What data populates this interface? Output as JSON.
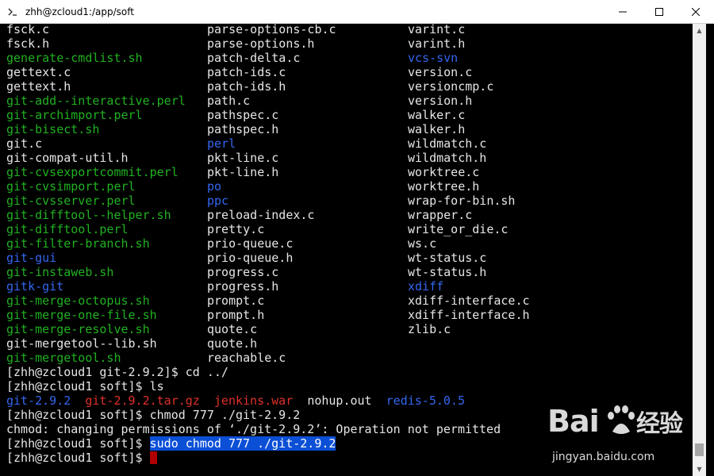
{
  "window": {
    "title": "zhh@zcloud1:/app/soft"
  },
  "colors": {
    "green": "#21b121",
    "blue": "#3467f0",
    "red": "#e0302a",
    "white": "#e6e6e6",
    "selection": "#0b4fd6",
    "cursor": "#b00000"
  },
  "listing": [
    [
      {
        "t": "fsck.c",
        "c": "w"
      },
      {
        "t": "parse-options-cb.c",
        "c": "w"
      },
      {
        "t": "varint.c",
        "c": "w"
      }
    ],
    [
      {
        "t": "fsck.h",
        "c": "w"
      },
      {
        "t": "parse-options.h",
        "c": "w"
      },
      {
        "t": "varint.h",
        "c": "w"
      }
    ],
    [
      {
        "t": "generate-cmdlist.sh",
        "c": "g"
      },
      {
        "t": "patch-delta.c",
        "c": "w"
      },
      {
        "t": "vcs-svn",
        "c": "b"
      }
    ],
    [
      {
        "t": "gettext.c",
        "c": "w"
      },
      {
        "t": "patch-ids.c",
        "c": "w"
      },
      {
        "t": "version.c",
        "c": "w"
      }
    ],
    [
      {
        "t": "gettext.h",
        "c": "w"
      },
      {
        "t": "patch-ids.h",
        "c": "w"
      },
      {
        "t": "versioncmp.c",
        "c": "w"
      }
    ],
    [
      {
        "t": "git-add--interactive.perl",
        "c": "g"
      },
      {
        "t": "path.c",
        "c": "w"
      },
      {
        "t": "version.h",
        "c": "w"
      }
    ],
    [
      {
        "t": "git-archimport.perl",
        "c": "g"
      },
      {
        "t": "pathspec.c",
        "c": "w"
      },
      {
        "t": "walker.c",
        "c": "w"
      }
    ],
    [
      {
        "t": "git-bisect.sh",
        "c": "g"
      },
      {
        "t": "pathspec.h",
        "c": "w"
      },
      {
        "t": "walker.h",
        "c": "w"
      }
    ],
    [
      {
        "t": "git.c",
        "c": "w"
      },
      {
        "t": "perl",
        "c": "b"
      },
      {
        "t": "wildmatch.c",
        "c": "w"
      }
    ],
    [
      {
        "t": "git-compat-util.h",
        "c": "w"
      },
      {
        "t": "pkt-line.c",
        "c": "w"
      },
      {
        "t": "wildmatch.h",
        "c": "w"
      }
    ],
    [
      {
        "t": "git-cvsexportcommit.perl",
        "c": "g"
      },
      {
        "t": "pkt-line.h",
        "c": "w"
      },
      {
        "t": "worktree.c",
        "c": "w"
      }
    ],
    [
      {
        "t": "git-cvsimport.perl",
        "c": "g"
      },
      {
        "t": "po",
        "c": "b"
      },
      {
        "t": "worktree.h",
        "c": "w"
      }
    ],
    [
      {
        "t": "git-cvsserver.perl",
        "c": "g"
      },
      {
        "t": "ppc",
        "c": "b"
      },
      {
        "t": "wrap-for-bin.sh",
        "c": "w"
      }
    ],
    [
      {
        "t": "git-difftool--helper.sh",
        "c": "g"
      },
      {
        "t": "preload-index.c",
        "c": "w"
      },
      {
        "t": "wrapper.c",
        "c": "w"
      }
    ],
    [
      {
        "t": "git-difftool.perl",
        "c": "g"
      },
      {
        "t": "pretty.c",
        "c": "w"
      },
      {
        "t": "write_or_die.c",
        "c": "w"
      }
    ],
    [
      {
        "t": "git-filter-branch.sh",
        "c": "g"
      },
      {
        "t": "prio-queue.c",
        "c": "w"
      },
      {
        "t": "ws.c",
        "c": "w"
      }
    ],
    [
      {
        "t": "git-gui",
        "c": "b"
      },
      {
        "t": "prio-queue.h",
        "c": "w"
      },
      {
        "t": "wt-status.c",
        "c": "w"
      }
    ],
    [
      {
        "t": "git-instaweb.sh",
        "c": "g"
      },
      {
        "t": "progress.c",
        "c": "w"
      },
      {
        "t": "wt-status.h",
        "c": "w"
      }
    ],
    [
      {
        "t": "gitk-git",
        "c": "b"
      },
      {
        "t": "progress.h",
        "c": "w"
      },
      {
        "t": "xdiff",
        "c": "b"
      }
    ],
    [
      {
        "t": "git-merge-octopus.sh",
        "c": "g"
      },
      {
        "t": "prompt.c",
        "c": "w"
      },
      {
        "t": "xdiff-interface.c",
        "c": "w"
      }
    ],
    [
      {
        "t": "git-merge-one-file.sh",
        "c": "g"
      },
      {
        "t": "prompt.h",
        "c": "w"
      },
      {
        "t": "xdiff-interface.h",
        "c": "w"
      }
    ],
    [
      {
        "t": "git-merge-resolve.sh",
        "c": "g"
      },
      {
        "t": "quote.c",
        "c": "w"
      },
      {
        "t": "zlib.c",
        "c": "w"
      }
    ],
    [
      {
        "t": "git-mergetool--lib.sh",
        "c": "w"
      },
      {
        "t": "quote.h",
        "c": "w"
      },
      {
        "t": "",
        "c": "w"
      }
    ],
    [
      {
        "t": "git-mergetool.sh",
        "c": "g"
      },
      {
        "t": "reachable.c",
        "c": "w"
      },
      {
        "t": "",
        "c": "w"
      }
    ]
  ],
  "session": {
    "cmd1": "[zhh@zcloud1 git-2.9.2]$ cd ../",
    "cmd2": "[zhh@zcloud1 soft]$ ls",
    "ls_items": [
      {
        "t": "git-2.9.2",
        "c": "b"
      },
      {
        "t": "git-2.9.2.tar.gz",
        "c": "r"
      },
      {
        "t": "jenkins.war",
        "c": "r"
      },
      {
        "t": "nohup.out",
        "c": "w"
      },
      {
        "t": "redis-5.0.5",
        "c": "b"
      }
    ],
    "cmd3": "[zhh@zcloud1 soft]$ chmod 777 ./git-2.9.2",
    "error": "chmod: changing permissions of ‘./git-2.9.2’: Operation not permitted",
    "prompt4": "[zhh@zcloud1 soft]$ ",
    "cmd4_selected": "sudo chmod 777 ./git-2.9.2",
    "prompt5": "[zhh@zcloud1 soft]$ "
  },
  "watermark": {
    "logo": "Bai du 经验",
    "url": "jingyan.baidu.com"
  }
}
